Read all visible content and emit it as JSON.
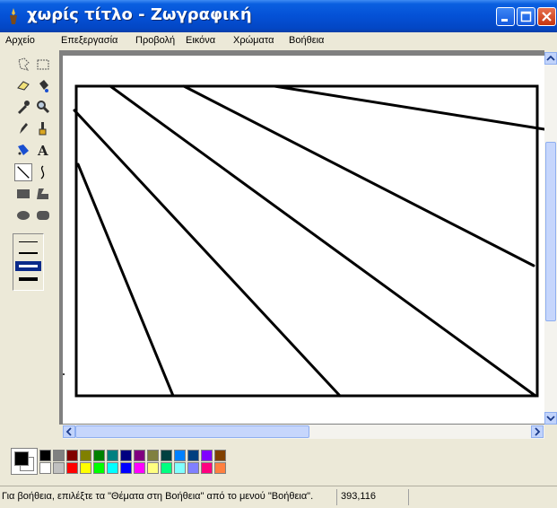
{
  "window": {
    "title": "χωρίς τίτλο - Ζωγραφική",
    "accent": "#0451d6"
  },
  "menu": {
    "items": [
      "Αρχείο",
      "Επεξεργασία",
      "Προβολή",
      "Εικόνα",
      "Χρώματα",
      "Βοήθεια"
    ]
  },
  "tools": [
    "free-select",
    "rect-select",
    "eraser",
    "fill",
    "color-picker",
    "magnifier",
    "pencil",
    "brush",
    "airbrush",
    "text",
    "line",
    "curve",
    "rectangle",
    "polygon",
    "ellipse",
    "rounded-rectangle"
  ],
  "active_tool": "line",
  "palette": {
    "foreground": "#000000",
    "background": "#ffffff",
    "row1": [
      "#000000",
      "#808080",
      "#800000",
      "#808000",
      "#008000",
      "#008080",
      "#000080",
      "#800080",
      "#808040",
      "#004040",
      "#0080ff",
      "#004080",
      "#8000ff",
      "#804000"
    ],
    "row2": [
      "#ffffff",
      "#c0c0c0",
      "#ff0000",
      "#ffff00",
      "#00ff00",
      "#00ffff",
      "#0000ff",
      "#ff00ff",
      "#ffff80",
      "#00ff80",
      "#80ffff",
      "#8080ff",
      "#ff0080",
      "#ff8040"
    ]
  },
  "statusbar": {
    "help_text": "Για βοήθεια, επιλέξτε τα \"Θέματα στη Βοήθεια\" από το μενού \"Βοήθεια\".",
    "coordinates": "393,116"
  }
}
